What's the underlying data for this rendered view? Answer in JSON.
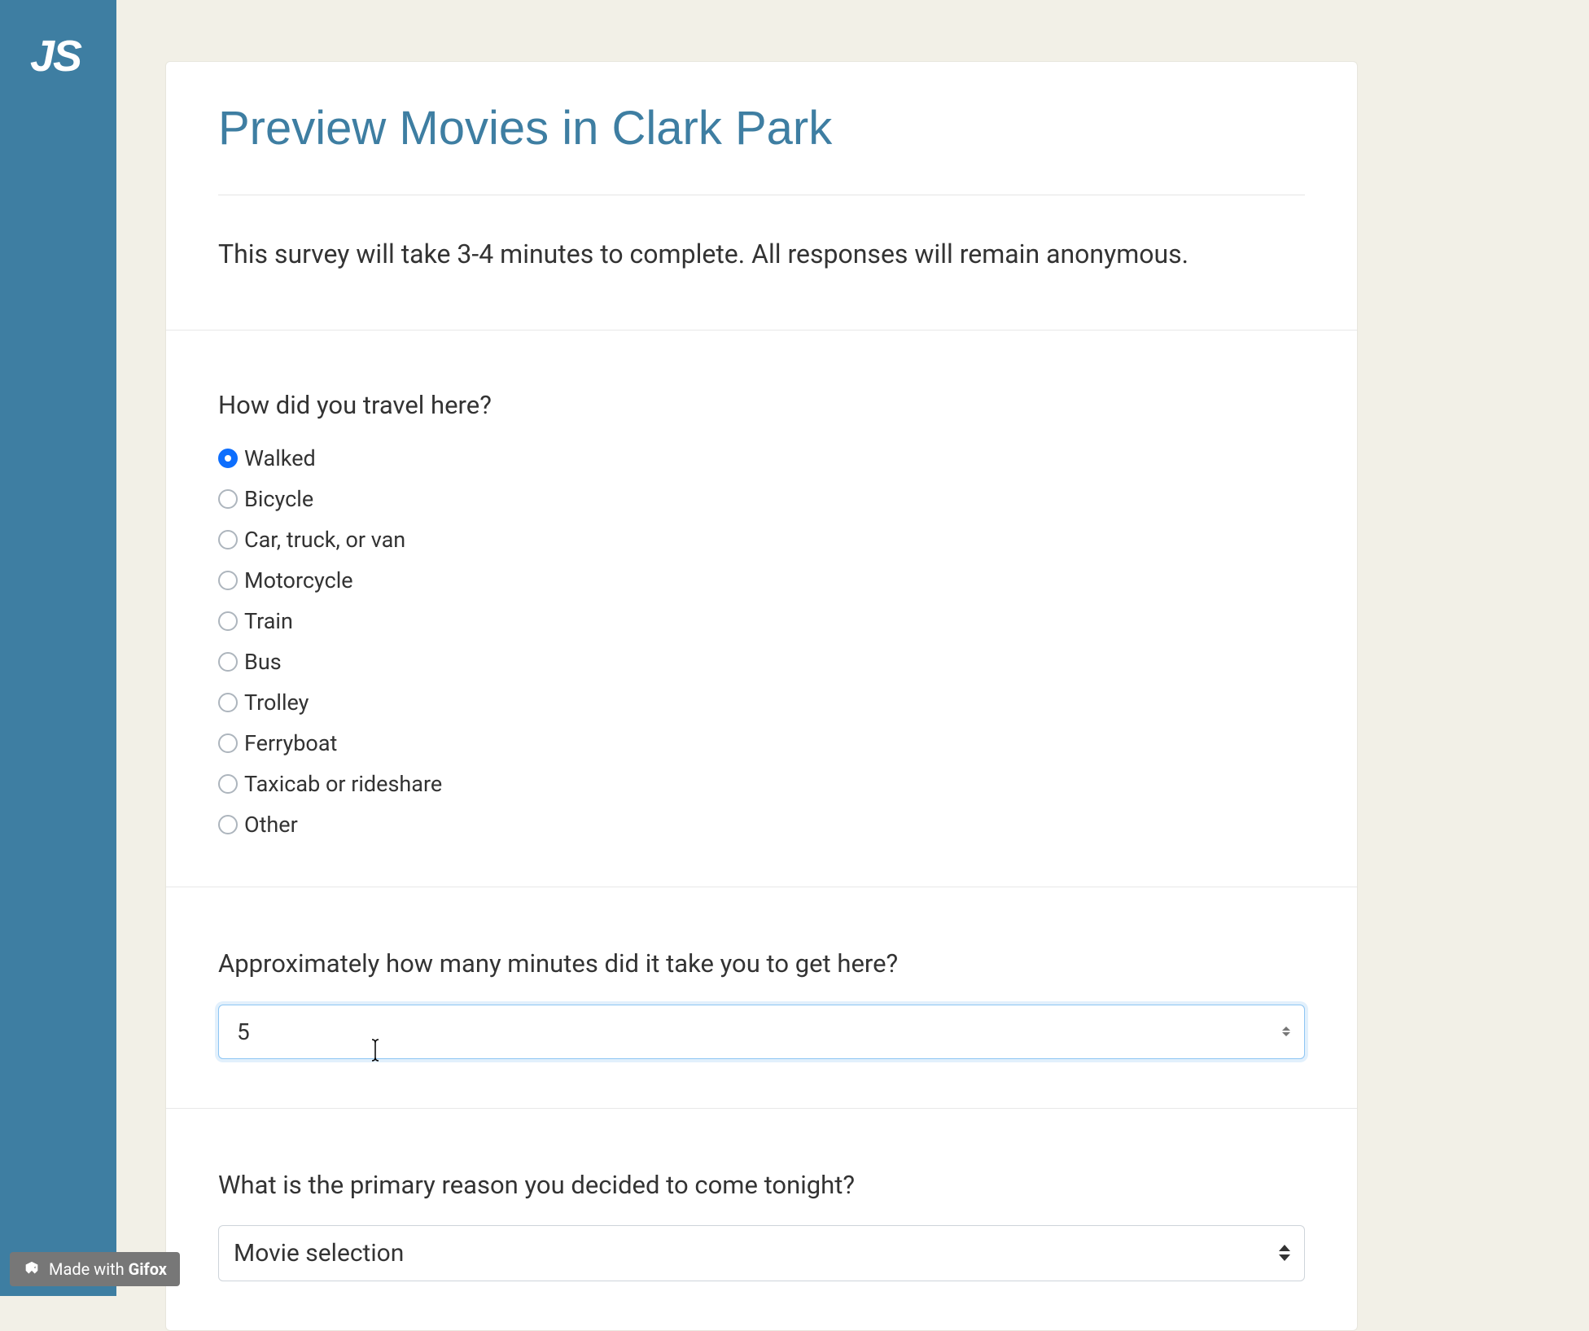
{
  "logo": "JS",
  "survey": {
    "title": "Preview Movies in Clark Park",
    "intro": "This survey will take 3-4 minutes to complete. All responses will remain anonymous."
  },
  "questions": {
    "travel": {
      "label": "How did you travel here?",
      "options": [
        {
          "label": "Walked",
          "checked": true
        },
        {
          "label": "Bicycle",
          "checked": false
        },
        {
          "label": "Car, truck, or van",
          "checked": false
        },
        {
          "label": "Motorcycle",
          "checked": false
        },
        {
          "label": "Train",
          "checked": false
        },
        {
          "label": "Bus",
          "checked": false
        },
        {
          "label": "Trolley",
          "checked": false
        },
        {
          "label": "Ferryboat",
          "checked": false
        },
        {
          "label": "Taxicab or rideshare",
          "checked": false
        },
        {
          "label": "Other",
          "checked": false
        }
      ]
    },
    "minutes": {
      "label": "Approximately how many minutes did it take you to get here?",
      "value": "5"
    },
    "reason": {
      "label": "What is the primary reason you decided to come tonight?",
      "selected": "Movie selection"
    }
  },
  "gifox": {
    "prefix": "Made with ",
    "brand": "Gifox"
  }
}
